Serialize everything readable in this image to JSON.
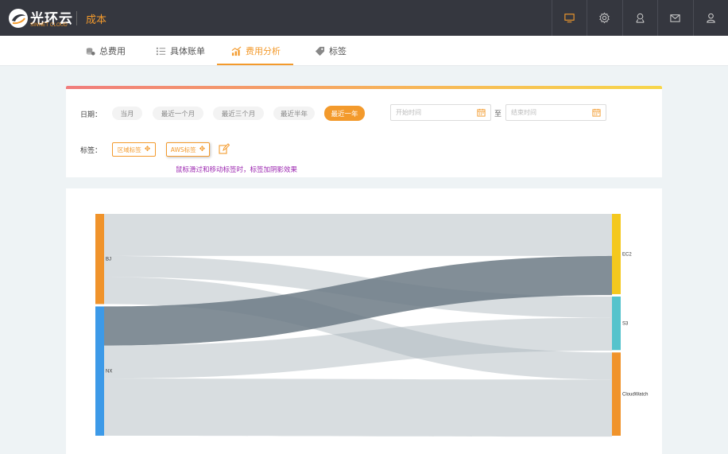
{
  "header": {
    "brand_name": "光环云",
    "brand_sub": "SINNET CLOUD",
    "title": "成本",
    "icons": [
      "monitor-icon",
      "gear-icon",
      "location-icon",
      "mail-icon",
      "user-icon"
    ]
  },
  "nav": {
    "tabs": [
      {
        "label": "总费用",
        "icon": "coins-icon"
      },
      {
        "label": "具体账单",
        "icon": "list-icon"
      },
      {
        "label": "费用分析",
        "icon": "chart-icon",
        "active": true
      },
      {
        "label": "标签",
        "icon": "tag-icon"
      }
    ]
  },
  "filters": {
    "date_label": "日期：",
    "ranges": [
      "当月",
      "最近一个月",
      "最近三个月",
      "最近半年",
      "最近一年"
    ],
    "active_range": "最近一年",
    "start_placeholder": "开始时间",
    "end_placeholder": "结束时间",
    "to_label": "至",
    "tag_label": "标签：",
    "tags": [
      "区域标签",
      "AWS标签"
    ],
    "hint": "鼠标滑过和移动标签时，标签加阴影效果"
  },
  "chart_data": {
    "type": "sankey",
    "nodes_left": [
      "BJ",
      "NX"
    ],
    "nodes_right": [
      "EC2",
      "S3",
      "CloudWatch"
    ],
    "colors": {
      "BJ": "#f0932b",
      "NX": "#3d9ae8",
      "EC2": "#f4c81e",
      "S3": "#55c3cc",
      "CloudWatch": "#f0932b"
    },
    "links": [
      {
        "source": "BJ",
        "target": "EC2",
        "value": 28
      },
      {
        "source": "BJ",
        "target": "S3",
        "value": 14
      },
      {
        "source": "BJ",
        "target": "CloudWatch",
        "value": 18
      },
      {
        "source": "NX",
        "target": "EC2",
        "value": 26
      },
      {
        "source": "NX",
        "target": "S3",
        "value": 22
      },
      {
        "source": "NX",
        "target": "CloudWatch",
        "value": 38
      }
    ]
  }
}
